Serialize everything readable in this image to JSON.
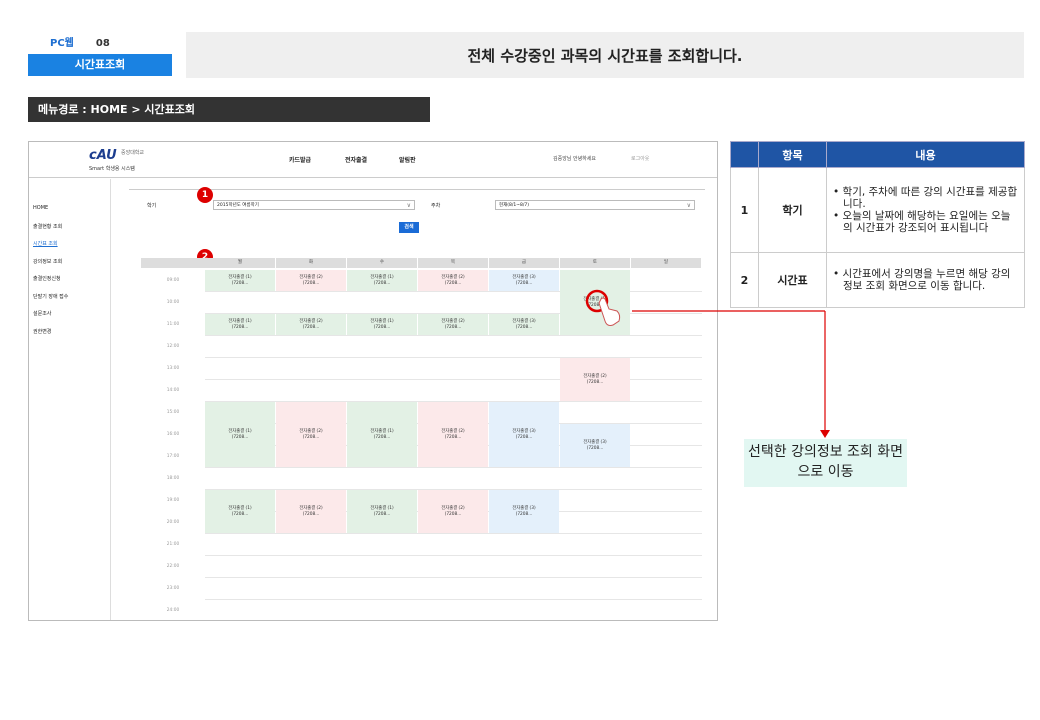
{
  "header": {
    "platform": "PC웹",
    "screen_no": "08",
    "screen_name": "시간표조회",
    "title": "전체 수강중인 과목의 시간표를 조회합니다.",
    "menu_path": "메뉴경로 : HOME > 시간표조회"
  },
  "mock": {
    "logo": "cAU",
    "logo_univ": "중앙대학교",
    "logo_sub": "Smart 학생용 시스템",
    "gnb": [
      "카드발급",
      "전자출결",
      "알림판"
    ],
    "hello": "김중앙님 안녕하세요",
    "logout": "로그아웃",
    "sidebar": [
      "HOME",
      "출결현황 조회",
      "시간표 조회",
      "강의정보 조회",
      "출결인정신청",
      "단말기 장애 접수",
      "설문조사",
      "권한변경"
    ],
    "sidebar_active": 2,
    "semester_label": "학기",
    "semester_value": "2015학년도 여름학기",
    "week_label": "주차",
    "week_value": "현재(8/1~8/7)",
    "search_button": "검색",
    "days": [
      "월",
      "화",
      "수",
      "목",
      "금",
      "토",
      "일"
    ],
    "times": [
      "09:00",
      "10:00",
      "11:00",
      "12:00",
      "13:00",
      "14:00",
      "15:00",
      "16:00",
      "17:00",
      "18:00",
      "19:00",
      "20:00",
      "21:00",
      "22:00",
      "23:00",
      "24:00"
    ],
    "classes": [
      {
        "day": 0,
        "start": 0,
        "span": 1,
        "name": "전자출결 (1)",
        "sub": "(7208...",
        "color": "g"
      },
      {
        "day": 1,
        "start": 0,
        "span": 1,
        "name": "전자출결 (2)",
        "sub": "(7208...",
        "color": "p"
      },
      {
        "day": 2,
        "start": 0,
        "span": 1,
        "name": "전자출결 (1)",
        "sub": "(7208...",
        "color": "g"
      },
      {
        "day": 3,
        "start": 0,
        "span": 1,
        "name": "전자출결 (2)",
        "sub": "(7208...",
        "color": "p"
      },
      {
        "day": 4,
        "start": 0,
        "span": 1,
        "name": "전자출결 (3)",
        "sub": "(7208...",
        "color": "b"
      },
      {
        "day": 5,
        "start": 0,
        "span": 3,
        "name": "전자출결 (1)",
        "sub": "(7208...",
        "color": "g"
      },
      {
        "day": 0,
        "start": 2,
        "span": 1,
        "name": "전자출결 (1)",
        "sub": "(7208...",
        "color": "g"
      },
      {
        "day": 1,
        "start": 2,
        "span": 1,
        "name": "전자출결 (2)",
        "sub": "(7208...",
        "color": "g"
      },
      {
        "day": 2,
        "start": 2,
        "span": 1,
        "name": "전자출결 (1)",
        "sub": "(7208...",
        "color": "g"
      },
      {
        "day": 3,
        "start": 2,
        "span": 1,
        "name": "전자출결 (2)",
        "sub": "(7208...",
        "color": "g"
      },
      {
        "day": 4,
        "start": 2,
        "span": 1,
        "name": "전자출결 (3)",
        "sub": "(7208...",
        "color": "g"
      },
      {
        "day": 5,
        "start": 4,
        "span": 2,
        "name": "전자출결 (2)",
        "sub": "(7208...",
        "color": "p"
      },
      {
        "day": 0,
        "start": 6,
        "span": 3,
        "name": "전자출결 (1)",
        "sub": "(7208...",
        "color": "g"
      },
      {
        "day": 1,
        "start": 6,
        "span": 3,
        "name": "전자출결 (2)",
        "sub": "(7208...",
        "color": "p"
      },
      {
        "day": 2,
        "start": 6,
        "span": 3,
        "name": "전자출결 (1)",
        "sub": "(7208...",
        "color": "g"
      },
      {
        "day": 3,
        "start": 6,
        "span": 3,
        "name": "전자출결 (2)",
        "sub": "(7208...",
        "color": "p"
      },
      {
        "day": 4,
        "start": 6,
        "span": 3,
        "name": "전자출결 (3)",
        "sub": "(7208...",
        "color": "b"
      },
      {
        "day": 5,
        "start": 7,
        "span": 2,
        "name": "전자출결 (3)",
        "sub": "(7208...",
        "color": "b"
      },
      {
        "day": 0,
        "start": 10,
        "span": 2,
        "name": "전자출결 (1)",
        "sub": "(7208...",
        "color": "g"
      },
      {
        "day": 1,
        "start": 10,
        "span": 2,
        "name": "전자출결 (2)",
        "sub": "(7208...",
        "color": "p"
      },
      {
        "day": 2,
        "start": 10,
        "span": 2,
        "name": "전자출결 (1)",
        "sub": "(7208...",
        "color": "g"
      },
      {
        "day": 3,
        "start": 10,
        "span": 2,
        "name": "전자출결 (2)",
        "sub": "(7208...",
        "color": "p"
      },
      {
        "day": 4,
        "start": 10,
        "span": 2,
        "name": "전자출결 (3)",
        "sub": "(7208...",
        "color": "b"
      }
    ],
    "badges": [
      "1",
      "2"
    ]
  },
  "info_table": {
    "headers": [
      "항목",
      "내용"
    ],
    "rows": [
      {
        "no": "1",
        "item": "학기",
        "desc": [
          "학기, 주차에 따른 강의 시간표를 제공합니다.",
          "오늘의 날짜에 해당하는 요일에는 오늘의 시간표가 강조되어 표시됩니다"
        ]
      },
      {
        "no": "2",
        "item": "시간표",
        "desc": [
          "시간표에서 강의명을 누르면 해당 강의정보 조회 화면으로 이동 합니다."
        ]
      }
    ]
  },
  "callout": "선택한 강의정보 조회 화면으로 이동",
  "colors": {
    "accent": "#1a82e2",
    "table_header": "#1f55a5",
    "arrow": "#d00000",
    "callout_bg": "#e2f7f2"
  }
}
